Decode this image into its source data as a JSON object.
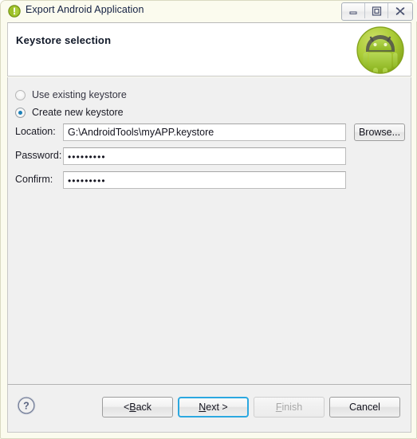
{
  "window": {
    "title": "Export Android Application",
    "icon": "android-bulb-icon",
    "controls": [
      {
        "name": "minimize-button",
        "glyph": "minimize-icon"
      },
      {
        "name": "restore-button",
        "glyph": "restore-icon"
      },
      {
        "name": "close-button",
        "glyph": "close-icon"
      }
    ]
  },
  "header": {
    "title": "Keystore selection",
    "logo": "android-robot-logo"
  },
  "options": {
    "use_existing": {
      "label": "Use existing keystore",
      "selected": false
    },
    "create_new": {
      "label": "Create new keystore",
      "selected": true
    }
  },
  "fields": {
    "location": {
      "label": "Location:",
      "value": "G:\\AndroidTools\\myAPP.keystore",
      "placeholder": ""
    },
    "password": {
      "label": "Password:",
      "value": "•••••••••",
      "placeholder": ""
    },
    "confirm": {
      "label": "Confirm:",
      "value": "•••••••••",
      "placeholder": ""
    },
    "browse": {
      "label": "Browse..."
    }
  },
  "footer": {
    "help": "help-icon",
    "buttons": {
      "back": {
        "prefix": "< ",
        "mnemonic": "B",
        "suffix": "ack",
        "enabled": true
      },
      "next": {
        "prefix": "",
        "mnemonic": "N",
        "suffix": "ext >",
        "enabled": true,
        "focused": true
      },
      "finish": {
        "prefix": "",
        "mnemonic": "F",
        "suffix": "inish",
        "enabled": false
      },
      "cancel": {
        "prefix": "",
        "mnemonic": "",
        "suffix": "Cancel",
        "enabled": true
      }
    }
  },
  "colors": {
    "frame": "#fbfbee",
    "panel": "#f0f0f0",
    "accent_focus": "#2ca8e0",
    "radio_dot": "#1b7fb8",
    "android_green": "#a4c639"
  }
}
